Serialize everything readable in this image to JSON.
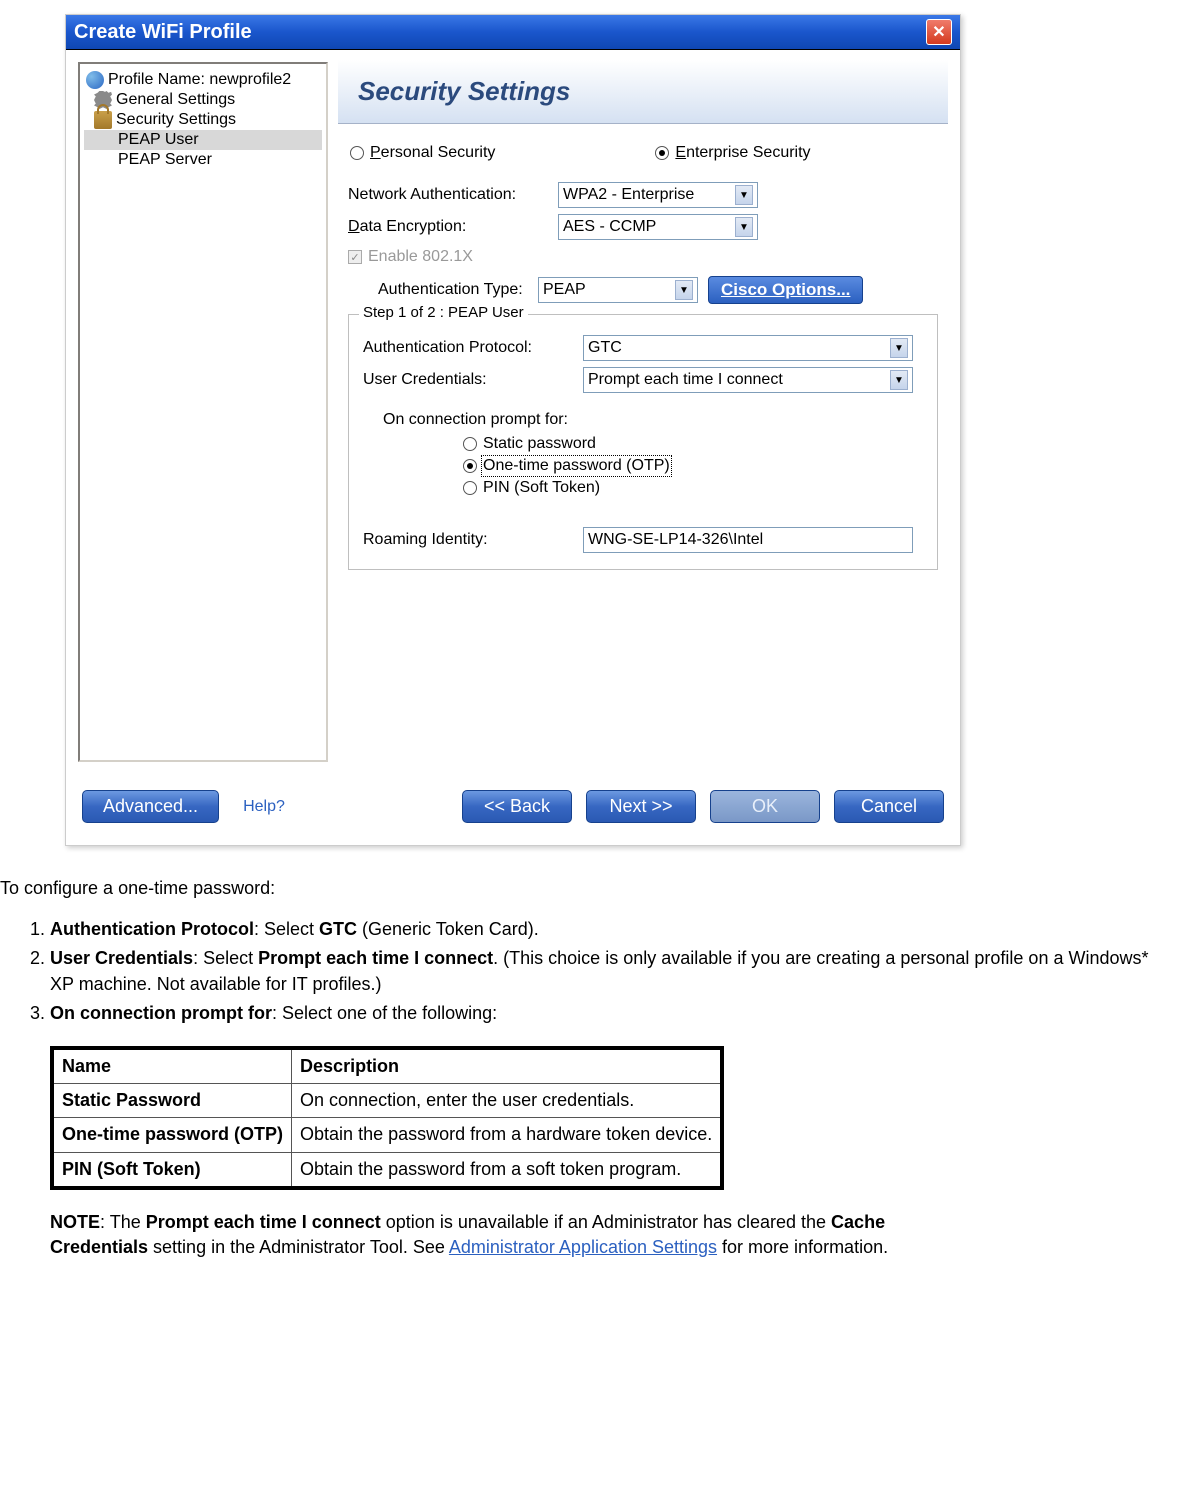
{
  "dialog": {
    "title": "Create WiFi Profile",
    "header": "Security Settings",
    "tree": {
      "profile": "Profile Name: newprofile2",
      "general": "General Settings",
      "security": "Security Settings",
      "peap_user": "PEAP User",
      "peap_server": "PEAP Server"
    },
    "security_mode": {
      "personal": "Personal Security",
      "enterprise": "Enterprise Security"
    },
    "labels": {
      "network_auth": "Network Authentication:",
      "data_encryption": "Data Encryption:",
      "enable_8021x": "Enable 802.1X",
      "auth_type": "Authentication Type:",
      "cisco_btn": "Cisco Options...",
      "group_legend": "Step 1 of 2 : PEAP User",
      "auth_protocol": "Authentication Protocol:",
      "user_credentials": "User Credentials:",
      "prompt_for": "On connection prompt for:",
      "roaming": "Roaming Identity:"
    },
    "values": {
      "network_auth": "WPA2 - Enterprise",
      "data_encryption": "AES - CCMP",
      "auth_type": "PEAP",
      "auth_protocol": "GTC",
      "user_credentials": "Prompt each time I connect",
      "roaming": "WNG-SE-LP14-326\\Intel"
    },
    "prompt_options": {
      "static": "Static password",
      "otp": "One-time password (OTP)",
      "pin": "PIN (Soft Token)"
    },
    "buttons": {
      "advanced": "Advanced...",
      "help": "Help?",
      "back": "<< Back",
      "next": "Next >>",
      "ok": "OK",
      "cancel": "Cancel"
    }
  },
  "doc": {
    "intro": "To configure a one-time password:",
    "step1_label": "Authentication Protocol",
    "step1_action": ": Select ",
    "step1_val": "GTC",
    "step1_suffix": " (Generic Token Card).",
    "step2_label": "User Credentials",
    "step2_action": ": Select ",
    "step2_val": "Prompt each time I connect",
    "step2_suffix": ". (This choice is only available if you are creating a personal profile on a Windows* XP machine. Not available for IT profiles.)",
    "step3_label": "On connection prompt for",
    "step3_suffix": ": Select one of the following:",
    "table": {
      "h1": "Name",
      "h2": "Description",
      "r1c1": "Static Password",
      "r1c2": "On connection, enter the user credentials.",
      "r2c1": "One-time password (OTP)",
      "r2c2": "Obtain the password from a hardware token device.",
      "r3c1": "PIN (Soft Token)",
      "r3c2": "Obtain the password from a soft token program."
    },
    "note_label": "NOTE",
    "note_t1": ": The ",
    "note_b1": "Prompt each time I connect",
    "note_t2": " option is unavailable if an Administrator has cleared the ",
    "note_b2": "Cache Credentials",
    "note_t3": " setting in the Administrator Tool. See ",
    "note_link": "Administrator Application Settings",
    "note_t4": " for more information."
  }
}
